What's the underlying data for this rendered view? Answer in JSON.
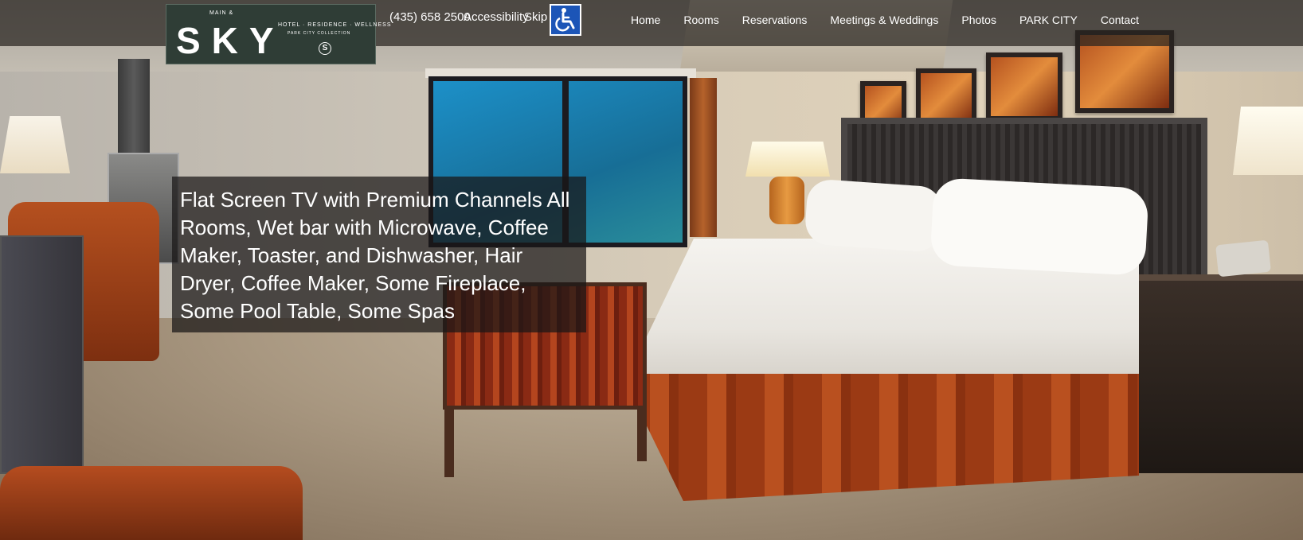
{
  "header": {
    "logo": {
      "small": "MAIN &",
      "main": "SKY",
      "sub": "HOTEL · RESIDENCE · WELLNESS",
      "sub2": "PARK CITY COLLECTION",
      "mark": "S"
    },
    "phone": "(435) 658 2500",
    "accessibility_label": "Accessibility",
    "skip_label": "Skip",
    "access_icon": "wheelchair-icon"
  },
  "nav": {
    "items": [
      {
        "label": "Home"
      },
      {
        "label": "Rooms"
      },
      {
        "label": "Reservations"
      },
      {
        "label": "Meetings & Weddings"
      },
      {
        "label": "Photos"
      },
      {
        "label": "PARK CITY"
      },
      {
        "label": "Contact"
      }
    ]
  },
  "hero": {
    "caption": "Flat Screen TV with Premium Channels All Rooms, Wet bar with Microwave, Coffee Maker, Toaster, and Dishwasher, Hair Dryer, Coffee Maker, Some Fireplace, Some Pool Table, Some Spas"
  },
  "colors": {
    "topbar": "#282420",
    "logo_bg": "#2f3d36",
    "access_icon_bg": "#1c55b7",
    "caption_bg": "#191616"
  }
}
